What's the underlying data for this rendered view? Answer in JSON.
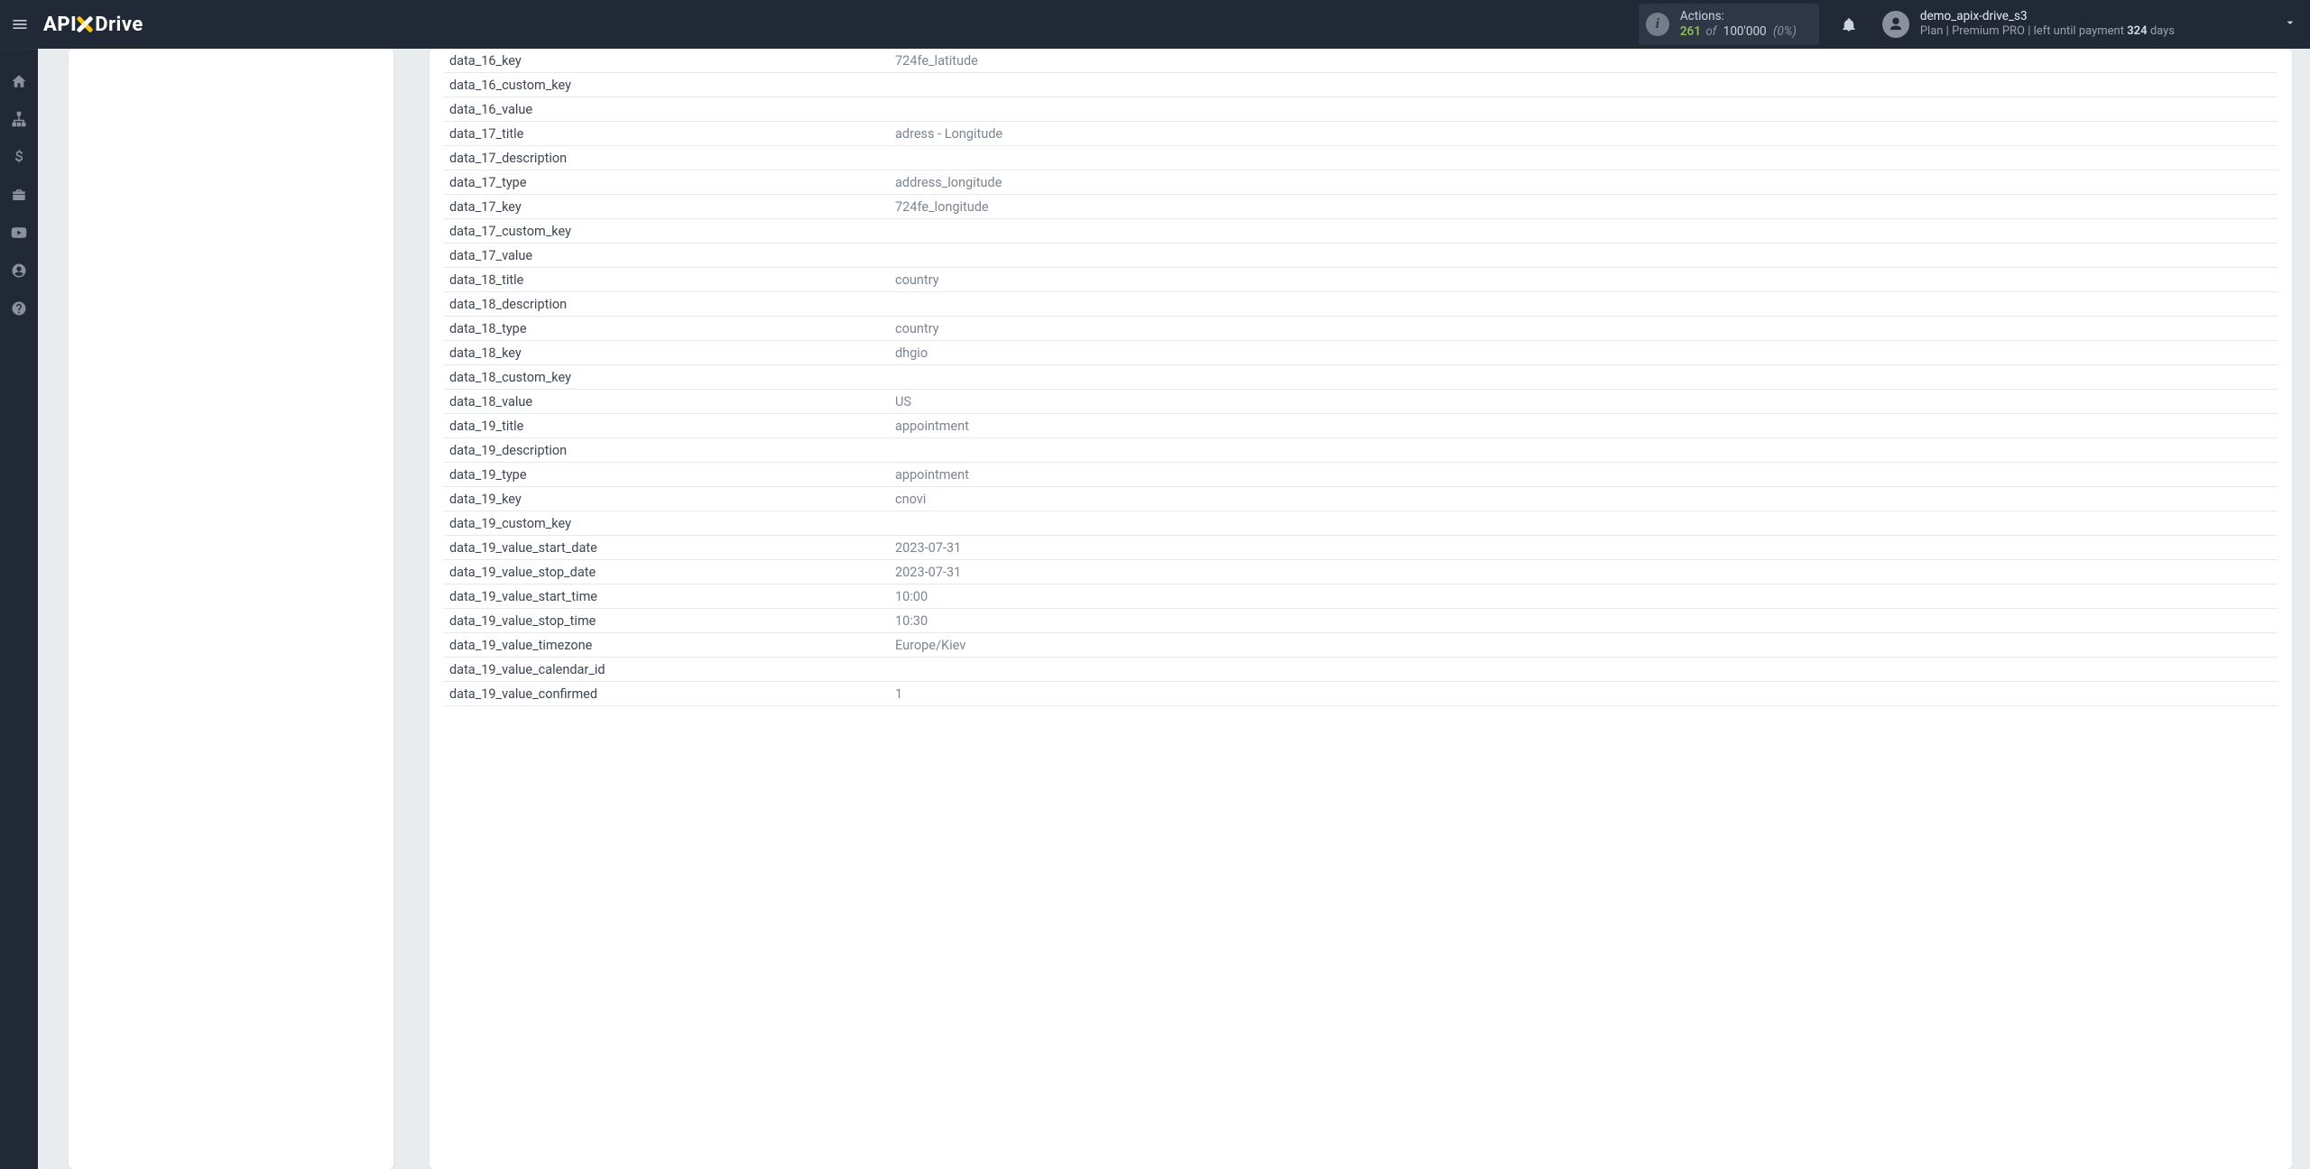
{
  "header": {
    "logo_api": "API",
    "logo_drive": "Drive",
    "actions_label": "Actions:",
    "actions_count": "261",
    "actions_of": "of",
    "actions_total": "100'000",
    "actions_pct": "(0%)",
    "username": "demo_apix-drive_s3",
    "plan_prefix": "Plan |",
    "plan_name": "Premium PRO",
    "plan_mid": "| left until payment",
    "days_value": "324",
    "days_suffix": "days"
  },
  "rows": [
    {
      "k": "data_16_key",
      "v": "724fe_latitude"
    },
    {
      "k": "data_16_custom_key",
      "v": ""
    },
    {
      "k": "data_16_value",
      "v": ""
    },
    {
      "k": "data_17_title",
      "v": "adress - Longitude"
    },
    {
      "k": "data_17_description",
      "v": ""
    },
    {
      "k": "data_17_type",
      "v": "address_longitude"
    },
    {
      "k": "data_17_key",
      "v": "724fe_longitude"
    },
    {
      "k": "data_17_custom_key",
      "v": ""
    },
    {
      "k": "data_17_value",
      "v": ""
    },
    {
      "k": "data_18_title",
      "v": "country"
    },
    {
      "k": "data_18_description",
      "v": ""
    },
    {
      "k": "data_18_type",
      "v": "country"
    },
    {
      "k": "data_18_key",
      "v": "dhgio"
    },
    {
      "k": "data_18_custom_key",
      "v": ""
    },
    {
      "k": "data_18_value",
      "v": "US"
    },
    {
      "k": "data_19_title",
      "v": "appointment"
    },
    {
      "k": "data_19_description",
      "v": ""
    },
    {
      "k": "data_19_type",
      "v": "appointment"
    },
    {
      "k": "data_19_key",
      "v": "cnovi"
    },
    {
      "k": "data_19_custom_key",
      "v": ""
    },
    {
      "k": "data_19_value_start_date",
      "v": "2023-07-31"
    },
    {
      "k": "data_19_value_stop_date",
      "v": "2023-07-31"
    },
    {
      "k": "data_19_value_start_time",
      "v": "10:00"
    },
    {
      "k": "data_19_value_stop_time",
      "v": "10:30"
    },
    {
      "k": "data_19_value_timezone",
      "v": "Europe/Kiev"
    },
    {
      "k": "data_19_value_calendar_id",
      "v": ""
    },
    {
      "k": "data_19_value_confirmed",
      "v": "1"
    }
  ]
}
